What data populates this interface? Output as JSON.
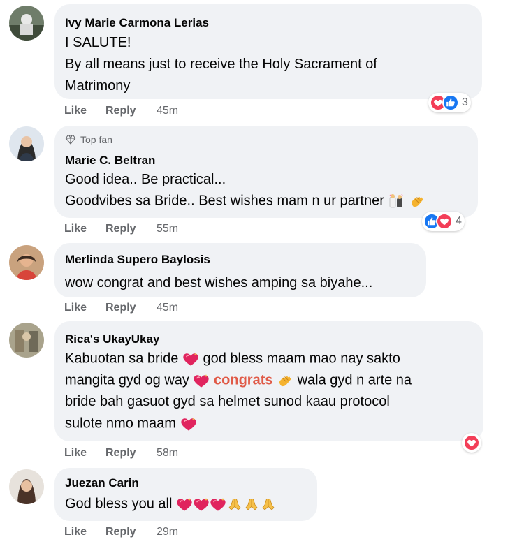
{
  "comments": [
    {
      "author": "Ivy Marie Carmona Lerias",
      "lines": [
        "I SALUTE!",
        "By all means just to receive the Holy Sacrament of",
        "Matrimony"
      ],
      "like": "Like",
      "reply": "Reply",
      "time": "45m",
      "reactions": [
        "love",
        "like"
      ],
      "reaction_count": "3"
    },
    {
      "badge": "Top fan",
      "author": "Marie C. Beltran",
      "lines": [
        "Good idea.. Be practical...",
        "Goodvibes sa Bride.. Best wishes mam n ur partner"
      ],
      "like": "Like",
      "reply": "Reply",
      "time": "55m",
      "reactions": [
        "like",
        "love"
      ],
      "reaction_count": "4"
    },
    {
      "author": "Merlinda Supero Baylosis",
      "lines": [
        "wow congrat and best wishes amping sa biyahe..."
      ],
      "like": "Like",
      "reply": "Reply",
      "time": "45m"
    },
    {
      "author": "Rica's UkayUkay",
      "lines": [
        "Kabuotan sa bride",
        "god bless maam mao nay sakto",
        "mangita gyd og way",
        "congrats",
        "wala gyd n arte na",
        "bride bah gasuot gyd sa helmet sunod kaau protocol",
        "sulote nmo maam"
      ],
      "like": "Like",
      "reply": "Reply",
      "time": "58m",
      "reactions": [
        "love"
      ]
    },
    {
      "author": "Juezan Carin",
      "lines": [
        "God bless you all"
      ],
      "like": "Like",
      "reply": "Reply",
      "time": "29m"
    }
  ],
  "icons": [
    "heart-reaction-icon",
    "like-reaction-icon",
    "top-fan-badge-icon",
    "sparkling-heart-emoji",
    "clapping-hands-emoji",
    "folded-hands-emoji",
    "wedding-emoji"
  ],
  "colors": {
    "bubble": "#f0f2f5",
    "like_blue": "#1877f2",
    "love_red": "#f33e58",
    "meta_gray": "#65676b",
    "congrats": "#e05a47"
  }
}
